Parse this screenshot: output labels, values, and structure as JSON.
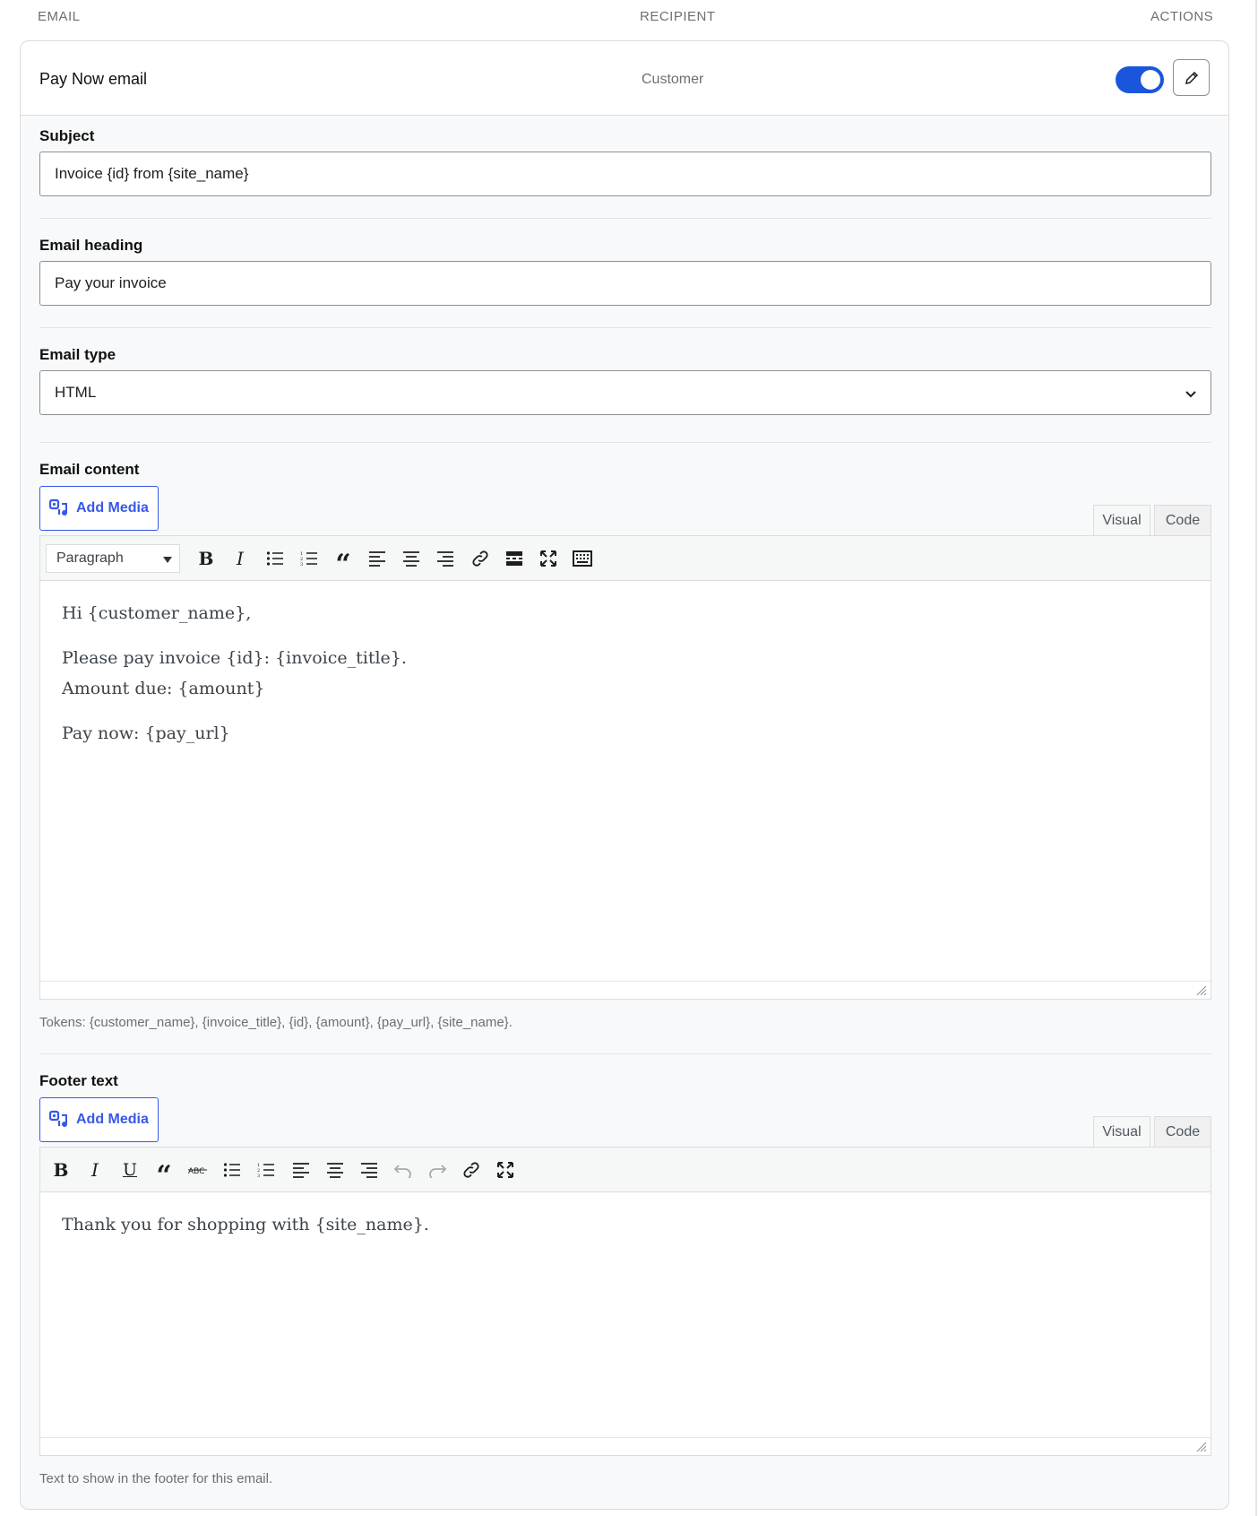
{
  "table_header": {
    "email": "EMAIL",
    "recipient": "RECIPIENT",
    "actions": "ACTIONS"
  },
  "row": {
    "email_name": "Pay Now email",
    "recipient": "Customer",
    "enabled": true,
    "accent_color": "#1a56db"
  },
  "subject": {
    "label": "Subject",
    "value": "Invoice {id} from {site_name}"
  },
  "heading": {
    "label": "Email heading",
    "value": "Pay your invoice"
  },
  "email_type": {
    "label": "Email type",
    "value": "HTML"
  },
  "content": {
    "label": "Email content",
    "add_media": "Add Media",
    "tab_visual": "Visual",
    "tab_code": "Code",
    "format": "Paragraph",
    "toolbar_icons": [
      "bold-icon",
      "italic-icon",
      "bullet-list-icon",
      "numbered-list-icon",
      "blockquote-icon",
      "align-left-icon",
      "align-center-icon",
      "align-right-icon",
      "link-icon",
      "read-more-icon",
      "fullscreen-icon",
      "toolbar-toggle-icon"
    ],
    "line1": "Hi {customer_name},",
    "line2": "Please pay invoice {id}: {invoice_title}.",
    "line3": "Amount due: {amount}",
    "line4": "Pay now: {pay_url}",
    "help": "Tokens: {customer_name}, {invoice_title}, {id}, {amount}, {pay_url}, {site_name}."
  },
  "footer": {
    "label": "Footer text",
    "add_media": "Add Media",
    "tab_visual": "Visual",
    "tab_code": "Code",
    "toolbar_icons": [
      "bold-icon",
      "italic-icon",
      "underline-icon",
      "blockquote-icon",
      "strikethrough-icon",
      "bullet-list-icon",
      "numbered-list-icon",
      "align-left-icon",
      "align-center-icon",
      "align-right-icon",
      "undo-icon",
      "redo-icon",
      "link-icon",
      "fullscreen-icon"
    ],
    "line1": "Thank you for shopping with {site_name}.",
    "help": "Text to show in the footer for this email."
  }
}
